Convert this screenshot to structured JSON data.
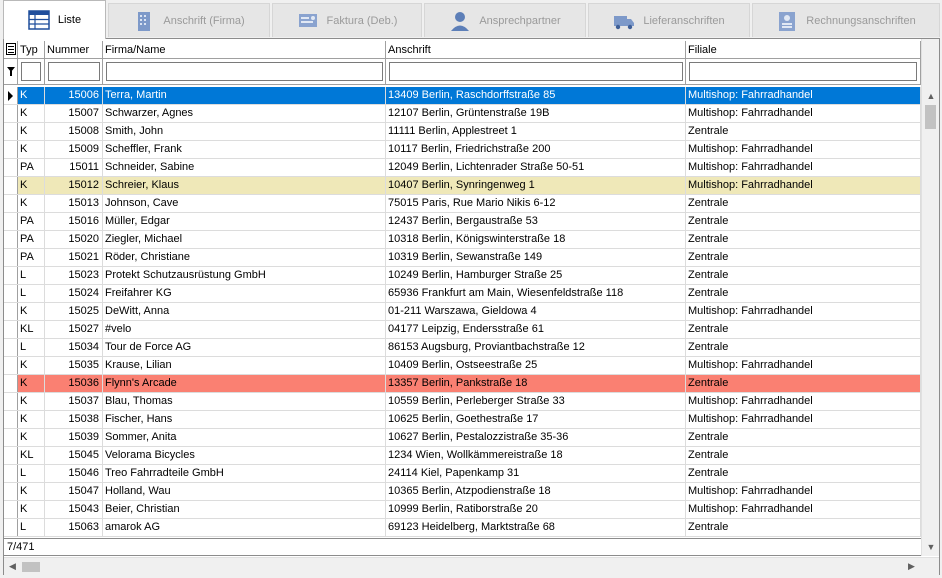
{
  "tabs": [
    {
      "label": "Liste",
      "icon": "grid-icon",
      "active": true
    },
    {
      "label": "Anschrift (Firma)",
      "icon": "building-icon",
      "active": false
    },
    {
      "label": "Faktura (Deb.)",
      "icon": "invoice-icon",
      "active": false
    },
    {
      "label": "Ansprechpartner",
      "icon": "person-icon",
      "active": false
    },
    {
      "label": "Lieferanschriften",
      "icon": "truck-icon",
      "active": false
    },
    {
      "label": "Rechnungsanschriften",
      "icon": "address-card-icon",
      "active": false
    }
  ],
  "columns": {
    "typ": "Typ",
    "nummer": "Nummer",
    "firma": "Firma/Name",
    "anschrift": "Anschrift",
    "filiale": "Filiale"
  },
  "filters": {
    "typ": "",
    "nummer": "",
    "firma": "",
    "anschrift": "",
    "filiale": ""
  },
  "rows": [
    {
      "typ": "K",
      "nummer": "15006",
      "firma": "Terra, Martin",
      "anschrift": "13409 Berlin, Raschdorffstraße 85",
      "filiale": "Multishop: Fahrradhandel",
      "state": "selected"
    },
    {
      "typ": "K",
      "nummer": "15007",
      "firma": "Schwarzer, Agnes",
      "anschrift": "12107 Berlin, Grüntenstraße 19B",
      "filiale": "Multishop: Fahrradhandel",
      "state": ""
    },
    {
      "typ": "K",
      "nummer": "15008",
      "firma": "Smith, John",
      "anschrift": "11111 Berlin, Applestreet 1",
      "filiale": "Zentrale",
      "state": ""
    },
    {
      "typ": "K",
      "nummer": "15009",
      "firma": "Scheffler, Frank",
      "anschrift": "10117 Berlin, Friedrichstraße 200",
      "filiale": "Multishop: Fahrradhandel",
      "state": ""
    },
    {
      "typ": "PA",
      "nummer": "15011",
      "firma": "Schneider, Sabine",
      "anschrift": "12049 Berlin, Lichtenrader Straße 50-51",
      "filiale": "Multishop: Fahrradhandel",
      "state": ""
    },
    {
      "typ": "K",
      "nummer": "15012",
      "firma": "Schreier, Klaus",
      "anschrift": "10407 Berlin, Synringenweg 1",
      "filiale": "Multishop: Fahrradhandel",
      "state": "yellow"
    },
    {
      "typ": "K",
      "nummer": "15013",
      "firma": "Johnson, Cave",
      "anschrift": "75015 Paris, Rue Mario Nikis 6-12",
      "filiale": "Zentrale",
      "state": ""
    },
    {
      "typ": "PA",
      "nummer": "15016",
      "firma": "Müller, Edgar",
      "anschrift": "12437 Berlin, Bergaustraße 53",
      "filiale": "Zentrale",
      "state": ""
    },
    {
      "typ": "PA",
      "nummer": "15020",
      "firma": "Ziegler, Michael",
      "anschrift": "10318 Berlin, Königswinterstraße 18",
      "filiale": "Zentrale",
      "state": ""
    },
    {
      "typ": "PA",
      "nummer": "15021",
      "firma": "Röder, Christiane",
      "anschrift": "10319 Berlin, Sewanstraße 149",
      "filiale": "Zentrale",
      "state": ""
    },
    {
      "typ": "L",
      "nummer": "15023",
      "firma": "Protekt Schutzausrüstung GmbH",
      "anschrift": "10249 Berlin, Hamburger Straße 25",
      "filiale": "Zentrale",
      "state": ""
    },
    {
      "typ": "L",
      "nummer": "15024",
      "firma": "Freifahrer KG",
      "anschrift": "65936 Frankfurt am Main, Wiesenfeldstraße 118",
      "filiale": "Zentrale",
      "state": ""
    },
    {
      "typ": "K",
      "nummer": "15025",
      "firma": "DeWitt, Anna",
      "anschrift": "01-211 Warszawa, Gieldowa 4",
      "filiale": "Multishop: Fahrradhandel",
      "state": ""
    },
    {
      "typ": "KL",
      "nummer": "15027",
      "firma": "#velo",
      "anschrift": "04177 Leipzig, Endersstraße 61",
      "filiale": "Zentrale",
      "state": ""
    },
    {
      "typ": "L",
      "nummer": "15034",
      "firma": "Tour de Force AG",
      "anschrift": "86153 Augsburg, Proviantbachstraße 12",
      "filiale": "Zentrale",
      "state": ""
    },
    {
      "typ": "K",
      "nummer": "15035",
      "firma": "Krause, Lilian",
      "anschrift": "10409 Berlin, Ostseestraße 25",
      "filiale": "Multishop: Fahrradhandel",
      "state": ""
    },
    {
      "typ": "K",
      "nummer": "15036",
      "firma": "Flynn's Arcade",
      "anschrift": "13357 Berlin, Pankstraße 18",
      "filiale": "Zentrale",
      "state": "red"
    },
    {
      "typ": "K",
      "nummer": "15037",
      "firma": "Blau, Thomas",
      "anschrift": "10559 Berlin, Perleberger Straße 33",
      "filiale": "Multishop: Fahrradhandel",
      "state": ""
    },
    {
      "typ": "K",
      "nummer": "15038",
      "firma": "Fischer, Hans",
      "anschrift": "10625 Berlin, Goethestraße 17",
      "filiale": "Multishop: Fahrradhandel",
      "state": ""
    },
    {
      "typ": "K",
      "nummer": "15039",
      "firma": "Sommer, Anita",
      "anschrift": "10627 Berlin, Pestalozzistraße 35-36",
      "filiale": "Zentrale",
      "state": ""
    },
    {
      "typ": "KL",
      "nummer": "15045",
      "firma": "Velorama Bicycles",
      "anschrift": "1234 Wien, Wollkämmereistraße 18",
      "filiale": "Zentrale",
      "state": ""
    },
    {
      "typ": "L",
      "nummer": "15046",
      "firma": "Treo Fahrradteile GmbH",
      "anschrift": "24114 Kiel, Papenkamp 31",
      "filiale": "Zentrale",
      "state": ""
    },
    {
      "typ": "K",
      "nummer": "15047",
      "firma": "Holland, Wau",
      "anschrift": "10365 Berlin, Atzpodienstraße 18",
      "filiale": "Multishop: Fahrradhandel",
      "state": ""
    },
    {
      "typ": "K",
      "nummer": "15043",
      "firma": "Beier, Christian",
      "anschrift": "10999 Berlin, Ratiborstraße 20",
      "filiale": "Multishop: Fahrradhandel",
      "state": ""
    },
    {
      "typ": "L",
      "nummer": "15063",
      "firma": "amarok AG",
      "anschrift": "69123 Heidelberg, Marktstraße 68",
      "filiale": "Zentrale",
      "state": ""
    }
  ],
  "footer": {
    "record_counter": "7/471"
  },
  "colors": {
    "selected": "#0078d7",
    "yellow": "#efe8b8",
    "red": "#fa8072"
  }
}
